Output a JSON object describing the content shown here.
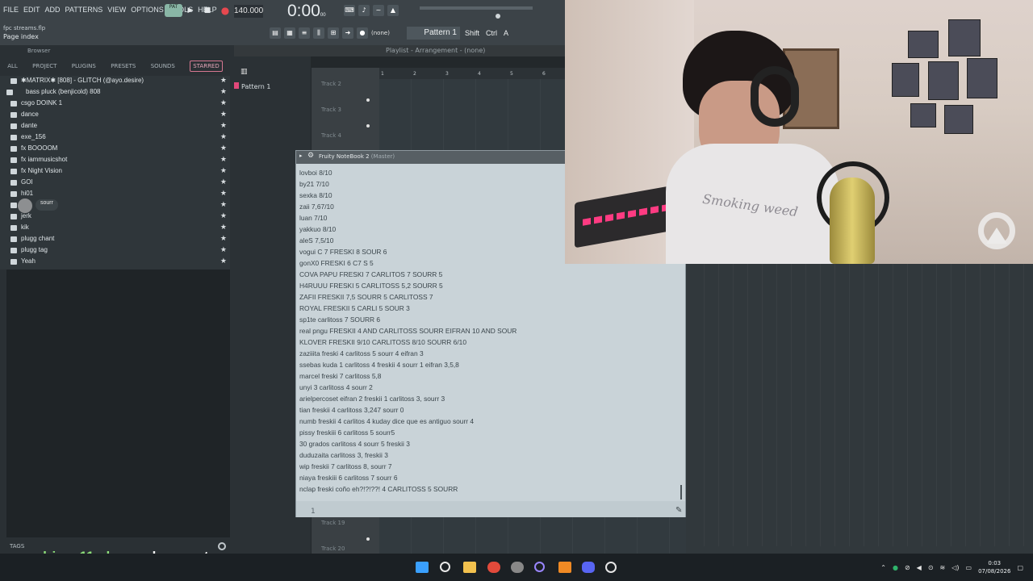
{
  "menu": {
    "items": [
      "FILE",
      "EDIT",
      "ADD",
      "PATTERNS",
      "VIEW",
      "OPTIONS",
      "TOOLS",
      "HELP"
    ],
    "pat_label": "PAT",
    "tempo": "140.000",
    "time_main": "0:00",
    "time_sub": "00",
    "time_unit": "M:S:CS"
  },
  "project": {
    "file_name": "fpc streams.flp",
    "hint": "Page index"
  },
  "toolbar2": {
    "none_label": "(none)",
    "pattern_label": "Pattern 1",
    "shift": "Shift",
    "ctrl": "Ctrl",
    "alt": "A"
  },
  "browser": {
    "title": "Browser",
    "tabs": [
      "ALL",
      "PROJECT",
      "PLUGINS",
      "PRESETS",
      "SOUNDS",
      "STARRED"
    ],
    "items": [
      {
        "label": "✱MATRIX✱ [808] - GLITCH (@ayo.desire)"
      },
      {
        "label": "bass pluck (benjicold) 808"
      },
      {
        "label": "csgo DOINK 1"
      },
      {
        "label": "dance"
      },
      {
        "label": "dante"
      },
      {
        "label": "exe_156"
      },
      {
        "label": "fx BOOOOM"
      },
      {
        "label": "fx iammusicshot"
      },
      {
        "label": "fx Night Vision"
      },
      {
        "label": "GOI"
      },
      {
        "label": "hi01"
      },
      {
        "label": ""
      },
      {
        "label": "jerk"
      },
      {
        "label": "kik"
      },
      {
        "label": "plugg chant"
      },
      {
        "label": "plugg tag"
      },
      {
        "label": "Yeah"
      }
    ],
    "hover_item": "sourr",
    "tags_label": "TAGS"
  },
  "playlist": {
    "header": "Playlist - Arrangement - (none)",
    "pattern_row": "Pattern 1",
    "tracks": [
      "Track 2",
      "Track 3",
      "Track 4",
      "Track 19",
      "Track 20"
    ],
    "timeline": [
      "1",
      "2",
      "3",
      "4",
      "5",
      "6"
    ]
  },
  "notebook": {
    "title": "Fruity NoteBook 2",
    "subtitle": "(Master)",
    "page_number": "1",
    "lines": [
      "lovboi 8/10",
      "by21 7/10",
      "sexka 8/10",
      "zaii 7,67/10",
      "luan 7/10",
      "yakkuo 8/10",
      "aleS 7,5/10",
      "vogui C 7 FRESKI 8 SOUR 6",
      "gonX0 FRESKI 6 C7 S 5",
      "COVA PAPU FRESKI 7 CARLITOS 7 SOURR 5",
      "H4RUUU FRESKI 5 CARLITOSS 5,2 SOURR 5",
      "ZAFII FRESKII 7,5 SOURR 5 CARLITOSS 7",
      "ROYAL FRESKII 5 CARLI 5 SOUR 3",
      "sp1te carlitoss 7 SOURR 6",
      "real pngu FRESKII 4 AND CARLITOSS SOURR EIFRAN 10 AND SOUR",
      "KLOVER FRESKII 9/10 CARLITOSS 8/10 SOURR 6/10",
      "zaziiita freski 4 carlitoss 5 sourr 4 eifran 3",
      "ssebas kuda 1 carlitoss 4 freskii 4 sourr 1 eifran 3,5,8",
      "marcel freski 7 carlitoss 5,8",
      "unyi 3 carlitoss 4 sourr 2",
      "arielpercoset eifran 2 freskii 1 carlitoss 3, sourr 3",
      "tian freskii 4 carlitoss 3,247 sourr 0",
      "numb freskii 4 carlitos 4 kuday dice que es antiguo sourr 4",
      "pissy freskiii 6 carlitoss 5 sourr5",
      "30 grados carlitoss 4 sourr 5 freskii 3",
      "duduzaita carlitoss 3, freskii 3",
      "wip freskii 7 carlitoss 8, sourr 7",
      "niaya freskiii 6 carlitoss 7 sourr 6",
      "nclap freski coño eh?!?!??! 4 CARLITOSS 5 SOURR"
    ]
  },
  "webcam": {
    "shirt_text": "Smoking weed"
  },
  "chat": {
    "user": "adriaan11xd",
    "message": "un valo pe neto"
  },
  "taskbar": {
    "time": "0:03",
    "date": "07/08/2026",
    "colors": {
      "start": "#3aa0ff",
      "folder": "#f2c14e",
      "chrome": "#e24a3b",
      "discord": "#5865f2",
      "fl": "#f08a24"
    }
  }
}
